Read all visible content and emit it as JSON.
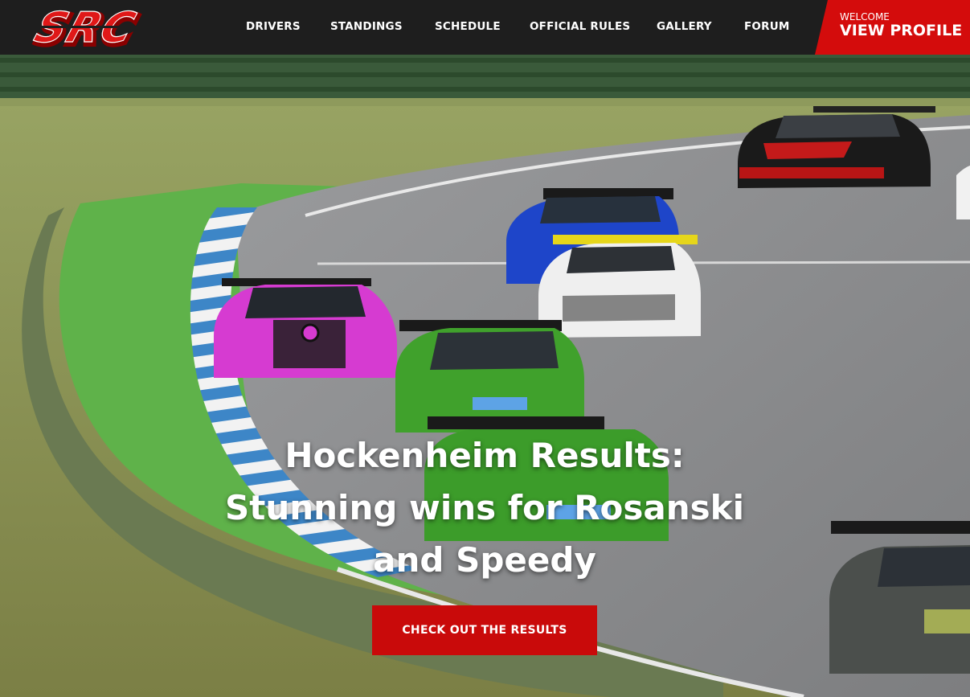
{
  "header": {
    "logo_text": "SRC",
    "nav": [
      {
        "label": "DRIVERS"
      },
      {
        "label": "STANDINGS"
      },
      {
        "label": "SCHEDULE"
      },
      {
        "label": "OFFICIAL RULES"
      },
      {
        "label": "GALLERY"
      },
      {
        "label": "FORUM"
      }
    ],
    "profile": {
      "welcome": "WELCOME",
      "label": "VIEW PROFILE"
    }
  },
  "hero": {
    "headline_lines": [
      "Hockenheim Results:",
      "Stunning wins for Rosanski",
      "and Speedy"
    ],
    "cta_label": "CHECK OUT THE RESULTS"
  },
  "colors": {
    "header_bg": "#1e1e1e",
    "accent_red": "#d40c0c",
    "button_red": "#c90a0a"
  }
}
